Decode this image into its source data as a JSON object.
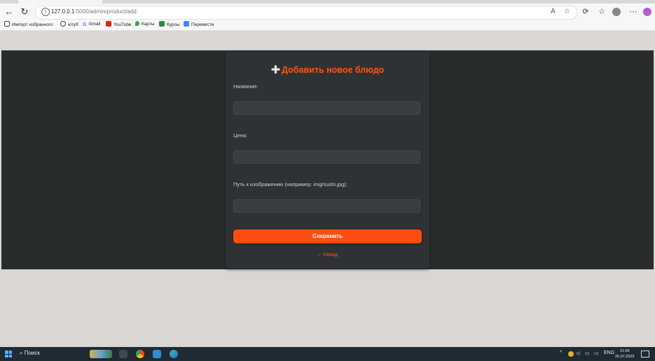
{
  "browser": {
    "url_host": "127.0.0.1",
    "url_rest": ":5000/admin/product/add",
    "bookmarks": [
      "Импорт избранного",
      "ютуб",
      "Gmail",
      "YouTube",
      "Карты",
      "Курсы",
      "Перевести"
    ]
  },
  "form": {
    "title": "Добавить новое блюдо",
    "name_label": "Название:",
    "price_label": "Цена:",
    "image_label": "Путь к изображению (например: img/sushi.jpg):",
    "save_label": "Сохранить",
    "back_label": "← Назад"
  },
  "taskbar": {
    "search_label": "Поиск",
    "lang": "ENG",
    "time": "21:06",
    "date": "25.07.2025"
  },
  "colors": {
    "accent": "#ff5418",
    "card_bg": "#2f3234",
    "band_bg": "#292c2c",
    "page_bg": "#d9d6d3"
  }
}
